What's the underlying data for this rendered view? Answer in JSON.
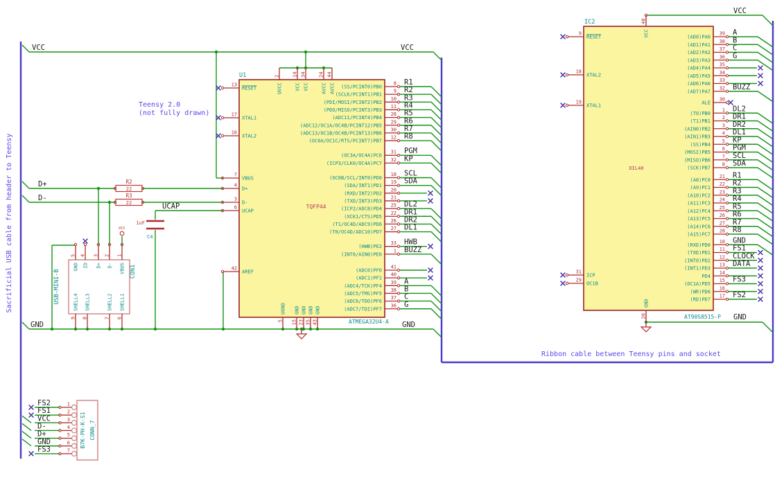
{
  "colors": {
    "wire": "#159415",
    "bus": "#4739c9",
    "pin": "#b02a2a",
    "device": "#c03434",
    "name_text": "#0d8c8c",
    "net_label": "#1a1a1a",
    "note": "#5948e8",
    "nc": "#2929b8",
    "body_fill": "#fbf5a0",
    "body_border": "#992121",
    "value_text": "#b83a5a",
    "connector_outline": "#cf8080"
  },
  "notes": {
    "left": "Sacrificial USB cable from header to Teensy",
    "teensy_line1": "Teensy 2.0",
    "teensy_line2": "(not fully drawn)",
    "ribbon": "Ribbon cable between Teensy pins and socket"
  },
  "net_labels": {
    "vcc_top_left": "VCC",
    "vcc_top_right": "VCC",
    "gnd_bottom_left": "GND",
    "gnd_bottom_right": "GND",
    "dplus": "D+",
    "dminus": "D-",
    "ucap": "UCAP",
    "ic2_vcc": "VCC",
    "ic2_gnd": "GND"
  },
  "u1": {
    "ref": "U1",
    "value": "TQFP44",
    "part": "ATMEGA32U4-A",
    "left_pins": [
      {
        "name": "RESET",
        "num": "13",
        "nc": true
      },
      {
        "name": "XTAL1",
        "num": "17",
        "nc": true
      },
      {
        "name": "XTAL2",
        "num": "16",
        "nc": true
      },
      {
        "name": "VBUS",
        "num": "7"
      },
      {
        "name": "D+",
        "num": "4"
      },
      {
        "name": "D-",
        "num": "3"
      },
      {
        "name": "UCAP",
        "num": "6"
      },
      {
        "name": "AREF",
        "num": "42"
      }
    ],
    "top_pins": [
      {
        "name": "UVCC",
        "num": "2"
      },
      {
        "name": "VCC",
        "num": "14"
      },
      {
        "name": "VCC",
        "num": "34"
      },
      {
        "name": "AVCC",
        "num": "24"
      },
      {
        "name": "AVCC",
        "num": "44"
      }
    ],
    "bottom_pins": [
      {
        "name": "UGND",
        "num": "5"
      },
      {
        "name": "GND",
        "num": "15"
      },
      {
        "name": "GND",
        "num": "23"
      },
      {
        "name": "GND",
        "num": "35"
      },
      {
        "name": "GND",
        "num": "43"
      }
    ],
    "right_pins": [
      {
        "name": "(SS/PCINT0)PB0",
        "num": "8",
        "net": "R1"
      },
      {
        "name": "(SCLK/PCINT1)PB1",
        "num": "9",
        "net": "R2"
      },
      {
        "name": "(PDI/MOSI/PCINT2)PB2",
        "num": "10",
        "net": "R3"
      },
      {
        "name": "(PDO/MISO/PCINT3)PB3",
        "num": "11",
        "net": "R4"
      },
      {
        "name": "(ADC11/PCINT4)PB4",
        "num": "28",
        "net": "R5"
      },
      {
        "name": "(ADC12/OC1A/OC4B/PCINT12)PB5",
        "num": "29",
        "net": "R6"
      },
      {
        "name": "(ADC13/OC1B/OC4B/PCINT13)PB6",
        "num": "30",
        "net": "R7"
      },
      {
        "name": "(OC0A/OC1C/RTS/PCINT7)PB7",
        "num": "12",
        "net": "R8"
      },
      {
        "name": "(OC3A/OC4A)PC6",
        "num": "31",
        "net": "PGM"
      },
      {
        "name": "(ICP3/CLK0/OC4A)PC7",
        "num": "32",
        "net": "KP"
      },
      {
        "name": "(OC0B/SCL/INT0)PD0",
        "num": "18",
        "net": "SCL"
      },
      {
        "name": "(SDA/INT1)PD1",
        "num": "19",
        "net": "SDA"
      },
      {
        "name": "(RXD/INT2)PD2",
        "num": "20",
        "nc": true
      },
      {
        "name": "(TXD/INT3)PD3",
        "num": "21",
        "nc": true
      },
      {
        "name": "(ICP2/ADC8)PD4",
        "num": "25",
        "net": "DL2"
      },
      {
        "name": "(XCK1/CTS)PD5",
        "num": "22",
        "net": "DR1"
      },
      {
        "name": "(T1/OC4D/ADC9)PD6",
        "num": "26",
        "net": "DR2"
      },
      {
        "name": "(T0/OC4D/ADC10)PD7",
        "num": "27",
        "net": "DL1"
      },
      {
        "name": "(HWB)PE2",
        "num": "33",
        "net": "HWB",
        "nc": true
      },
      {
        "name": "(INT6/AIN0)PE6",
        "num": "1",
        "net": "BUZZ"
      },
      {
        "name": "(ADC0)PF0",
        "num": "41",
        "nc": true
      },
      {
        "name": "(ADC1)PF1",
        "num": "40",
        "nc": true
      },
      {
        "name": "(ADC4/TCK)PF4",
        "num": "39",
        "net": "A"
      },
      {
        "name": "(ADC5/TMS)PF5",
        "num": "38",
        "net": "B"
      },
      {
        "name": "(ADC6/TDO)PF6",
        "num": "37",
        "net": "C"
      },
      {
        "name": "(ADC7/TDI)PF7",
        "num": "36",
        "net": "G"
      }
    ]
  },
  "ic2": {
    "ref": "IC2",
    "value": "DIL40",
    "part": "AT90S8515-P",
    "top_pin": {
      "name": "VCC",
      "num": "40"
    },
    "bottom_pin": {
      "name": "GND",
      "num": "20"
    },
    "left_pins": [
      {
        "name": "RESET",
        "num": "9",
        "nc": true
      },
      {
        "name": "XTAL2",
        "num": "18",
        "nc": true
      },
      {
        "name": "XTAL1",
        "num": "19",
        "nc": true
      },
      {
        "name": "ICP",
        "num": "31",
        "nc": true
      },
      {
        "name": "OC1B",
        "num": "29",
        "nc": true
      }
    ],
    "right_pins": [
      {
        "name": "(AD0)PA0",
        "num": "39",
        "net": "A"
      },
      {
        "name": "(AD1)PA1",
        "num": "38",
        "net": "B"
      },
      {
        "name": "(AD2)PA2",
        "num": "37",
        "net": "C"
      },
      {
        "name": "(AD3)PA3",
        "num": "36",
        "net": "G"
      },
      {
        "name": "(AD4)PA4",
        "num": "35",
        "nc": true
      },
      {
        "name": "(AD5)PA5",
        "num": "34",
        "nc": true
      },
      {
        "name": "(AD6)PA6",
        "num": "33",
        "nc": true
      },
      {
        "name": "(AD7)PA7",
        "num": "32",
        "net": "BUZZ"
      },
      {
        "name": "ALE",
        "num": "30",
        "nc": true
      },
      {
        "name": "(T0)PB0",
        "num": "1",
        "net": "DL2"
      },
      {
        "name": "(T1)PB1",
        "num": "2",
        "net": "DR1"
      },
      {
        "name": "(AIN0)PB2",
        "num": "3",
        "net": "DR2"
      },
      {
        "name": "(AIN1)PB3",
        "num": "4",
        "net": "DL1"
      },
      {
        "name": "(SS)PB4",
        "num": "5",
        "net": "KP"
      },
      {
        "name": "(MOSI)PB5",
        "num": "6",
        "net": "PGM"
      },
      {
        "name": "(MISO)PB6",
        "num": "7",
        "net": "SCL"
      },
      {
        "name": "(SCK)PB7",
        "num": "8",
        "net": "SDA"
      },
      {
        "name": "(A8)PC0",
        "num": "21",
        "net": "R1"
      },
      {
        "name": "(A9)PC1",
        "num": "22",
        "net": "R2"
      },
      {
        "name": "(A10)PC2",
        "num": "23",
        "net": "R3"
      },
      {
        "name": "(A11)PC3",
        "num": "24",
        "net": "R4"
      },
      {
        "name": "(A12)PC4",
        "num": "25",
        "net": "R5"
      },
      {
        "name": "(A13)PC5",
        "num": "26",
        "net": "R6"
      },
      {
        "name": "(A14)PC6",
        "num": "27",
        "net": "R7"
      },
      {
        "name": "(A15)PC7",
        "num": "28",
        "net": "R8"
      },
      {
        "name": "(RXD)PD0",
        "num": "10",
        "net": "GND"
      },
      {
        "name": "(TXD)PD1",
        "num": "11",
        "net": "FS1",
        "nc": true
      },
      {
        "name": "(INT0)PD2",
        "num": "12",
        "net": "CLOCK",
        "nc": true
      },
      {
        "name": "(INT1)PD3",
        "num": "13",
        "net": "DATA",
        "nc": true
      },
      {
        "name": "PD4",
        "num": "14",
        "nc": true
      },
      {
        "name": "(OC1A)PD5",
        "num": "15",
        "net": "FS3",
        "nc": true
      },
      {
        "name": "(WR)PD6",
        "num": "16",
        "nc": true
      },
      {
        "name": "(RD)PD7",
        "num": "17",
        "net": "FS2",
        "nc": true
      }
    ]
  },
  "r2": {
    "ref": "R2",
    "value": "22"
  },
  "r3": {
    "ref": "R3",
    "value": "22"
  },
  "c4": {
    "ref": "C4",
    "value": "1uF"
  },
  "vcc_port": {
    "label": "VCC"
  },
  "con1": {
    "ref": "CON1",
    "part": "USB-MINI-B",
    "top_pins": [
      {
        "name": "GND",
        "num": "5"
      },
      {
        "name": "ID",
        "num": "4",
        "nc": true
      },
      {
        "name": "D+",
        "num": "3"
      },
      {
        "name": "D-",
        "num": "2"
      },
      {
        "name": "VBUS",
        "num": "1"
      }
    ],
    "bottom_pins": [
      {
        "name": "SHELL4",
        "num": "9"
      },
      {
        "name": "SHELL3",
        "num": "8"
      },
      {
        "name": "SHELL2",
        "num": "7"
      },
      {
        "name": "SHELL1",
        "num": "6"
      }
    ]
  },
  "conn7": {
    "ref": "CONN_7",
    "part": "B7K-PH-K-S1",
    "pins": [
      {
        "net": "FS2",
        "num": "1",
        "nc": true
      },
      {
        "net": "FS1",
        "num": "2",
        "nc": true
      },
      {
        "net": "VCC",
        "num": "3"
      },
      {
        "net": "D-",
        "num": "4"
      },
      {
        "net": "D+",
        "num": "5"
      },
      {
        "net": "GND",
        "num": "6"
      },
      {
        "net": "FS3",
        "num": "7",
        "nc": true
      }
    ]
  }
}
